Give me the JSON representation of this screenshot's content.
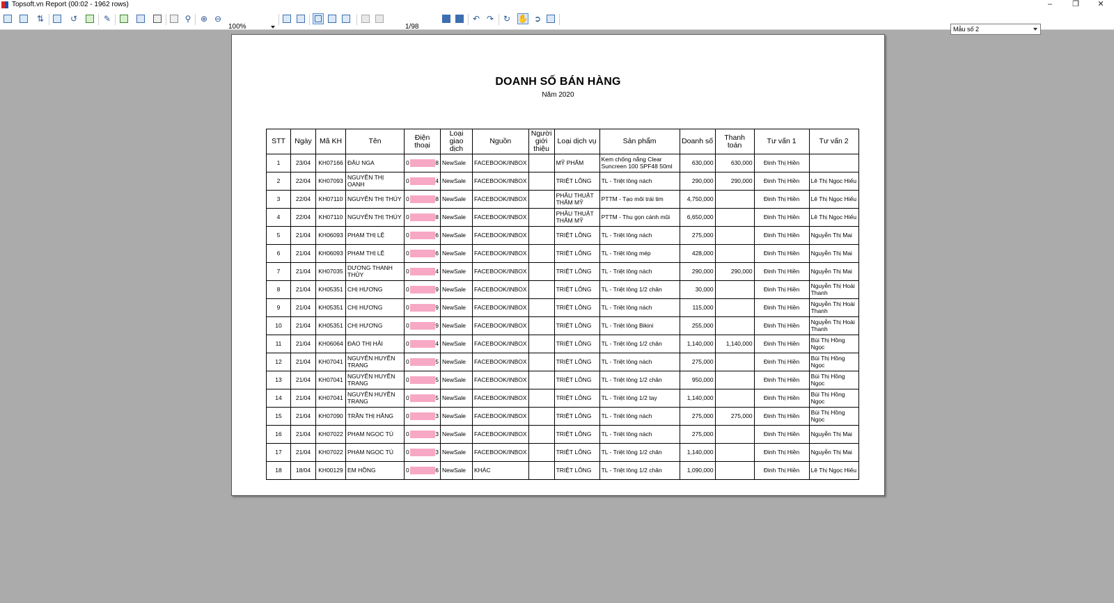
{
  "window": {
    "title": "Topsoft.vn Report (00:02 - 1962 rows)"
  },
  "toolbar": {
    "zoom": "100%",
    "page_indicator": "1/98",
    "template": "Mẫu số 2"
  },
  "report": {
    "title": "DOANH SỐ BÁN HÀNG",
    "subtitle": "Năm 2020",
    "columns": [
      "STT",
      "Ngày",
      "Mã KH",
      "Tên",
      "Điện thoại",
      "Loại giao dịch",
      "Nguồn",
      "Người giới thiệu",
      "Loại dịch vụ",
      "Sản phẩm",
      "Doanh số",
      "Thanh toán",
      "Tư vấn 1",
      "Tư vấn 2"
    ],
    "rows": [
      {
        "stt": "1",
        "date": "23/04",
        "code": "KH07166",
        "name": "ĐẬU NGA",
        "phone_first": "0",
        "phone_last": "8",
        "type": "NewSale",
        "source": "FACEBOOK/INBOX",
        "referrer": "",
        "service": "MỸ PHẨM",
        "product": "Kem chống nắng Clear Suncreen 100 SPF48 50ml",
        "revenue": "630,000",
        "payment": "630,000",
        "advisor1": "Đinh Thị Hiền",
        "advisor2": ""
      },
      {
        "stt": "2",
        "date": "22/04",
        "code": "KH07093",
        "name": "NGUYỄN THỊ OANH",
        "phone_first": "0",
        "phone_last": "4",
        "type": "NewSale",
        "source": "FACEBOOK/INBOX",
        "referrer": "",
        "service": "TRIỆT LÔNG",
        "product": "TL - Triệt lông nách",
        "revenue": "290,000",
        "payment": "290,000",
        "advisor1": "Đinh Thị Hiền",
        "advisor2": "Lê Thị Ngọc Hiếu"
      },
      {
        "stt": "3",
        "date": "22/04",
        "code": "KH07110",
        "name": "NGUYỄN THỊ THÚY",
        "phone_first": "0",
        "phone_last": "8",
        "type": "NewSale",
        "source": "FACEBOOK/INBOX",
        "referrer": "",
        "service": "PHẪU THUẬT THẨM MỸ",
        "product": "PTTM - Tạo môi trái tim",
        "revenue": "4,750,000",
        "payment": "",
        "advisor1": "Đinh Thị Hiền",
        "advisor2": "Lê Thị Ngọc Hiếu"
      },
      {
        "stt": "4",
        "date": "22/04",
        "code": "KH07110",
        "name": "NGUYỄN THỊ THÚY",
        "phone_first": "0",
        "phone_last": "8",
        "type": "NewSale",
        "source": "FACEBOOK/INBOX",
        "referrer": "",
        "service": "PHẪU THUẬT THẨM MỸ",
        "product": "PTTM - Thu gọn cánh mũi",
        "revenue": "6,650,000",
        "payment": "",
        "advisor1": "Đinh Thị Hiền",
        "advisor2": "Lê Thị Ngọc Hiếu"
      },
      {
        "stt": "5",
        "date": "21/04",
        "code": "KH06093",
        "name": "PHẠM THỊ LỆ",
        "phone_first": "0",
        "phone_last": "6",
        "type": "NewSale",
        "source": "FACEBOOK/INBOX",
        "referrer": "",
        "service": "TRIỆT LÔNG",
        "product": "TL - Triệt lông nách",
        "revenue": "275,000",
        "payment": "",
        "advisor1": "Đinh Thị Hiền",
        "advisor2": "Nguyễn Thị Mai"
      },
      {
        "stt": "6",
        "date": "21/04",
        "code": "KH06093",
        "name": "PHẠM THỊ LỆ",
        "phone_first": "0",
        "phone_last": "6",
        "type": "NewSale",
        "source": "FACEBOOK/INBOX",
        "referrer": "",
        "service": "TRIỆT LÔNG",
        "product": "TL - Triệt lông mép",
        "revenue": "428,000",
        "payment": "",
        "advisor1": "Đinh Thị Hiền",
        "advisor2": "Nguyễn Thị Mai"
      },
      {
        "stt": "7",
        "date": "21/04",
        "code": "KH07035",
        "name": "DƯƠNG THANH THỦY",
        "phone_first": "0",
        "phone_last": "4",
        "type": "NewSale",
        "source": "FACEBOOK/INBOX",
        "referrer": "",
        "service": "TRIỆT LÔNG",
        "product": "TL - Triệt lông nách",
        "revenue": "290,000",
        "payment": "290,000",
        "advisor1": "Đinh Thị Hiền",
        "advisor2": "Nguyễn Thị Mai"
      },
      {
        "stt": "8",
        "date": "21/04",
        "code": "KH05351",
        "name": "CHỊ HƯƠNG",
        "phone_first": "0",
        "phone_last": "9",
        "type": "NewSale",
        "source": "FACEBOOK/INBOX",
        "referrer": "",
        "service": "TRIỆT LÔNG",
        "product": "TL - Triệt lông 1/2 chân",
        "revenue": "30,000",
        "payment": "",
        "advisor1": "Đinh Thị Hiền",
        "advisor2": "Nguyễn Thị Hoài Thanh"
      },
      {
        "stt": "9",
        "date": "21/04",
        "code": "KH05351",
        "name": "CHỊ HƯƠNG",
        "phone_first": "0",
        "phone_last": "9",
        "type": "NewSale",
        "source": "FACEBOOK/INBOX",
        "referrer": "",
        "service": "TRIỆT LÔNG",
        "product": "TL - Triệt lông nách",
        "revenue": "115,000",
        "payment": "",
        "advisor1": "Đinh Thị Hiền",
        "advisor2": "Nguyễn Thị Hoài Thanh"
      },
      {
        "stt": "10",
        "date": "21/04",
        "code": "KH05351",
        "name": "CHỊ HƯƠNG",
        "phone_first": "0",
        "phone_last": "9",
        "type": "NewSale",
        "source": "FACEBOOK/INBOX",
        "referrer": "",
        "service": "TRIỆT LÔNG",
        "product": "TL - Triệt lông Bikini",
        "revenue": "255,000",
        "payment": "",
        "advisor1": "Đinh Thị Hiền",
        "advisor2": "Nguyễn Thị Hoài Thanh"
      },
      {
        "stt": "11",
        "date": "21/04",
        "code": "KH06064",
        "name": "ĐÀO THỊ HẢI",
        "phone_first": "0",
        "phone_last": "4",
        "type": "NewSale",
        "source": "FACEBOOK/INBOX",
        "referrer": "",
        "service": "TRIỆT LÔNG",
        "product": "TL - Triệt lông 1/2 chân",
        "revenue": "1,140,000",
        "payment": "1,140,000",
        "advisor1": "Đinh Thị Hiền",
        "advisor2": "Bùi Thị Hồng Ngọc"
      },
      {
        "stt": "12",
        "date": "21/04",
        "code": "KH07041",
        "name": "NGUYỄN HUYỀN TRANG",
        "phone_first": "0",
        "phone_last": "5",
        "type": "NewSale",
        "source": "FACEBOOK/INBOX",
        "referrer": "",
        "service": "TRIỆT LÔNG",
        "product": "TL - Triệt lông nách",
        "revenue": "275,000",
        "payment": "",
        "advisor1": "Đinh Thị Hiền",
        "advisor2": "Bùi Thị Hồng Ngọc"
      },
      {
        "stt": "13",
        "date": "21/04",
        "code": "KH07041",
        "name": "NGUYỄN HUYỀN TRANG",
        "phone_first": "0",
        "phone_last": "5",
        "type": "NewSale",
        "source": "FACEBOOK/INBOX",
        "referrer": "",
        "service": "TRIỆT LÔNG",
        "product": "TL - Triệt lông 1/2 chân",
        "revenue": "950,000",
        "payment": "",
        "advisor1": "Đinh Thị Hiền",
        "advisor2": "Bùi Thị Hồng Ngọc"
      },
      {
        "stt": "14",
        "date": "21/04",
        "code": "KH07041",
        "name": "NGUYỄN HUYỀN TRANG",
        "phone_first": "0",
        "phone_last": "5",
        "type": "NewSale",
        "source": "FACEBOOK/INBOX",
        "referrer": "",
        "service": "TRIỆT LÔNG",
        "product": "TL - Triệt lông 1/2 tay",
        "revenue": "1,140,000",
        "payment": "",
        "advisor1": "Đinh Thị Hiền",
        "advisor2": "Bùi Thị Hồng Ngọc"
      },
      {
        "stt": "15",
        "date": "21/04",
        "code": "KH07090",
        "name": "TRẦN THỊ HẰNG",
        "phone_first": "0",
        "phone_last": "3",
        "type": "NewSale",
        "source": "FACEBOOK/INBOX",
        "referrer": "",
        "service": "TRIỆT LÔNG",
        "product": "TL - Triệt lông nách",
        "revenue": "275,000",
        "payment": "275,000",
        "advisor1": "Đinh Thị Hiền",
        "advisor2": "Bùi Thị Hồng Ngọc"
      },
      {
        "stt": "16",
        "date": "21/04",
        "code": "KH07022",
        "name": "PHẠM NGỌC TÚ",
        "phone_first": "0",
        "phone_last": "3",
        "type": "NewSale",
        "source": "FACEBOOK/INBOX",
        "referrer": "",
        "service": "TRIỆT LÔNG",
        "product": "TL - Triệt lông nách",
        "revenue": "275,000",
        "payment": "",
        "advisor1": "Đinh Thị Hiền",
        "advisor2": "Nguyễn Thị Mai"
      },
      {
        "stt": "17",
        "date": "21/04",
        "code": "KH07022",
        "name": "PHẠM NGỌC TÚ",
        "phone_first": "0",
        "phone_last": "3",
        "type": "NewSale",
        "source": "FACEBOOK/INBOX",
        "referrer": "",
        "service": "TRIỆT LÔNG",
        "product": "TL - Triệt lông 1/2 chân",
        "revenue": "1,140,000",
        "payment": "",
        "advisor1": "Đinh Thị Hiền",
        "advisor2": "Nguyễn Thị Mai"
      },
      {
        "stt": "18",
        "date": "18/04",
        "code": "KH00129",
        "name": "EM HỒNG",
        "phone_first": "0",
        "phone_last": "6",
        "type": "NewSale",
        "source": "KHÁC",
        "referrer": "",
        "service": "TRIỆT LÔNG",
        "product": "TL - Triệt lông 1/2 chân",
        "revenue": "1,090,000",
        "payment": "",
        "advisor1": "Đinh Thị Hiền",
        "advisor2": "Lê Thị Ngọc Hiếu"
      }
    ]
  }
}
